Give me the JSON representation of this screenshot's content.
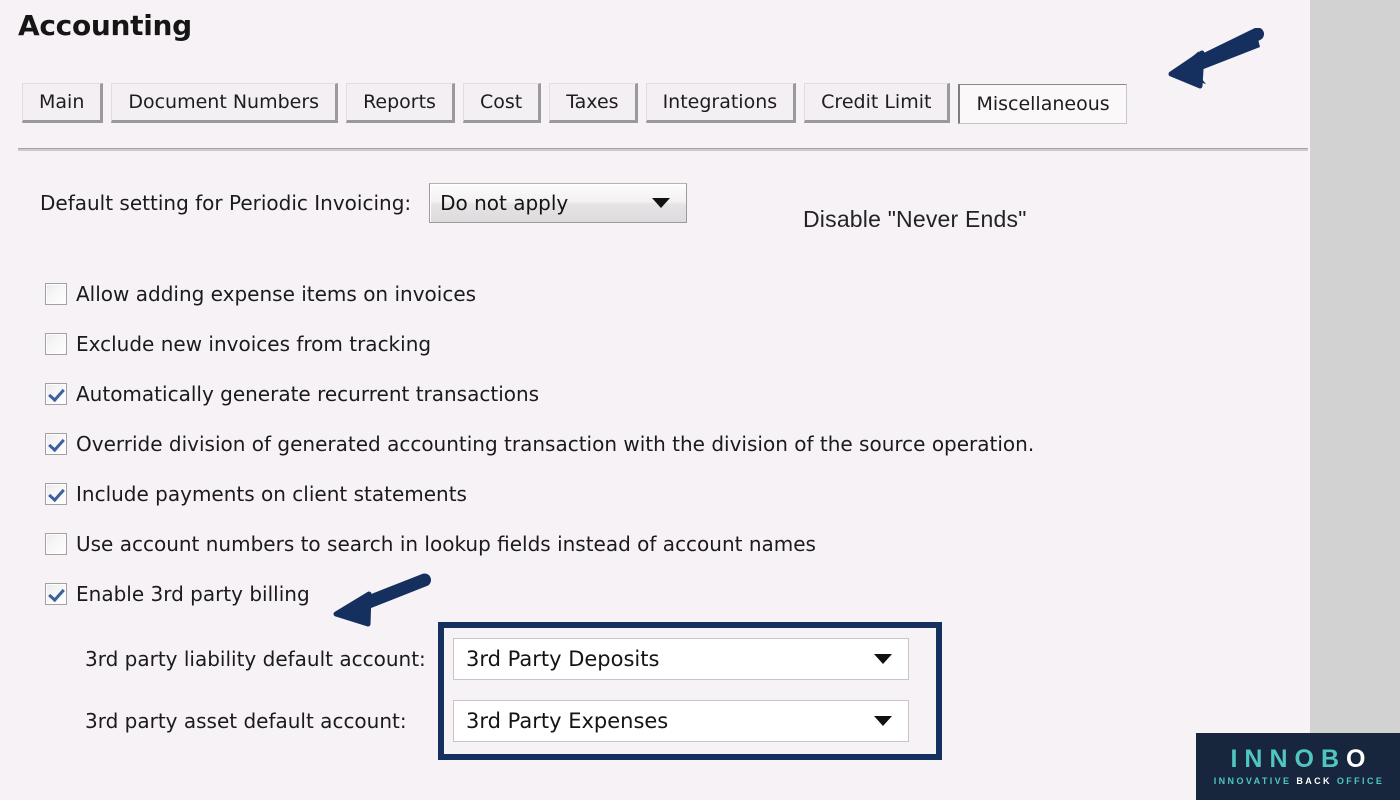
{
  "page": {
    "title": "Accounting",
    "background_color": "#f7f2f6",
    "accent_navy": "#15305e"
  },
  "tabs": [
    {
      "label": "Main",
      "active": false
    },
    {
      "label": "Document Numbers",
      "active": false
    },
    {
      "label": "Reports",
      "active": false
    },
    {
      "label": "Cost",
      "active": false
    },
    {
      "label": "Taxes",
      "active": false
    },
    {
      "label": "Integrations",
      "active": false
    },
    {
      "label": "Credit Limit",
      "active": false
    },
    {
      "label": "Miscellaneous",
      "active": true
    }
  ],
  "periodic": {
    "label": "Default setting for Periodic Invoicing:",
    "value": "Do not apply",
    "options": [
      "Do not apply"
    ],
    "caret_icon": "chevron-down-icon"
  },
  "annotation": {
    "note_text": "Disable \"Never Ends\"",
    "arrow_top_icon": "arrow-left-icon",
    "arrow_3rd_party_icon": "arrow-left-icon",
    "color": "#15305e"
  },
  "checkboxes": [
    {
      "label": "Allow adding expense items on invoices",
      "checked": false
    },
    {
      "label": "Exclude new invoices from tracking",
      "checked": false
    },
    {
      "label": "Automatically generate recurrent transactions",
      "checked": true
    },
    {
      "label": "Override division of generated accounting transaction with the division of the source operation.",
      "checked": true
    },
    {
      "label": "Include payments on client statements",
      "checked": true
    },
    {
      "label": "Use account numbers to search in lookup fields instead of account names",
      "checked": false
    },
    {
      "label": "Enable 3rd party billing",
      "checked": true
    }
  ],
  "third_party": {
    "liability": {
      "label": "3rd party liability default account:",
      "value": "3rd Party Deposits",
      "options": [
        "3rd Party Deposits"
      ]
    },
    "asset": {
      "label": "3rd party asset default account:",
      "value": "3rd Party Expenses",
      "options": [
        "3rd Party Expenses"
      ]
    }
  },
  "logo": {
    "word_teal": "INNOB",
    "word_white": "O",
    "tag_part1": "INNOVATIVE",
    "tag_part2": "BACK",
    "tag_part3": "OFFICE",
    "teal": "#4fc6c0",
    "background": "#17263c"
  }
}
